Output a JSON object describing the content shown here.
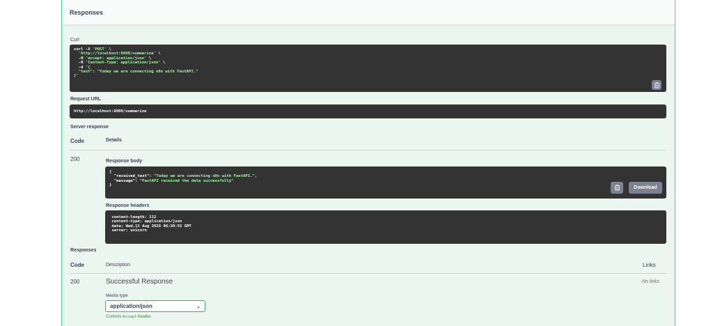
{
  "header": {
    "title": "Responses"
  },
  "curl": {
    "label": "Curl",
    "lines": [
      [
        "curl -X ",
        "'POST'",
        " \\"
      ],
      [
        "  ",
        "'http://localhost:8000/summarize'",
        " \\"
      ],
      [
        "  -H ",
        "'accept: application/json'",
        " \\"
      ],
      [
        "  -H ",
        "'Content-Type: application/json'",
        " \\"
      ],
      [
        "  -d ",
        "'{",
        ""
      ],
      [
        "  ",
        "\"text\": \"Today we are connecting n8n with FastAPI.\"",
        ""
      ],
      [
        "",
        "}'",
        ""
      ]
    ]
  },
  "request_url": {
    "label": "Request URL",
    "value": "http://localhost:8000/summarize"
  },
  "server_response": {
    "label": "Server response",
    "code_header": "Code",
    "details_header": "Details",
    "code": "200",
    "body_label": "Response body",
    "body_lines": [
      [
        "{",
        ""
      ],
      [
        "  \"received_text\": ",
        "\"Today we are connecting n8n with FastAPI.\","
      ],
      [
        "  \"message\": ",
        "\"FastAPI received the data successfully\""
      ],
      [
        "}",
        ""
      ]
    ],
    "download_label": "Download",
    "headers_label": "Response headers",
    "header_lines": [
      " content-length: 112 ",
      " content-type: application/json ",
      " date: Wed,12 Aug 2026 06:30:55 GMT ",
      " server: uvicorn "
    ]
  },
  "responses": {
    "label": "Responses",
    "code_header": "Code",
    "description_header": "Description",
    "links_header": "Links",
    "code": "200",
    "description": "Successful Response",
    "links": "No links",
    "media_type_label": "Media type",
    "media_type_value": "application/json",
    "help_prefix": "Controls ",
    "help_code": "Accept",
    "help_suffix": " header."
  },
  "icons": {
    "copy": "clipboard-icon",
    "dropdown": "chevron-down-icon"
  },
  "colors": {
    "accent": "#49cc90",
    "panel_bg": "#ecf6f0",
    "code_bg": "#333333",
    "string": "#a2fca2"
  }
}
